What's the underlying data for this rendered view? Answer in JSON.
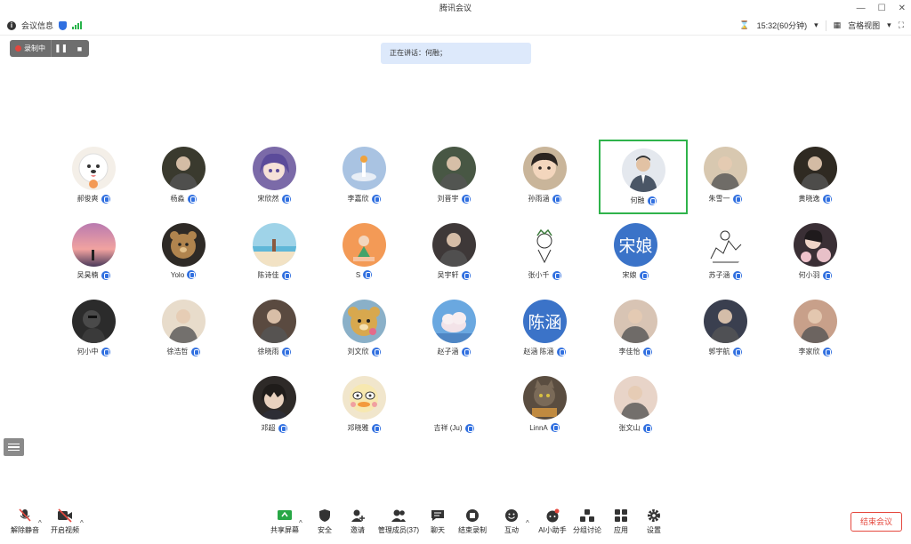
{
  "window": {
    "title": "腾讯会议"
  },
  "infobar": {
    "meeting_info": "会议信息",
    "time": "15:32(60分钟)",
    "layout": "宫格视图"
  },
  "recording": {
    "label": "录制中"
  },
  "speaking": {
    "text": "正在讲话：何融；"
  },
  "participants": [
    {
      "name": "郝俊爽",
      "avatar": "dog",
      "bg": "#f4efe8"
    },
    {
      "name": "杨淼",
      "avatar": "photo",
      "bg": "#3a3a2e"
    },
    {
      "name": "宋欣然",
      "avatar": "anime",
      "bg": "#7b6aa8"
    },
    {
      "name": "李嘉欣",
      "avatar": "sky",
      "bg": "#a9c3e2"
    },
    {
      "name": "刘晋宇",
      "avatar": "photo",
      "bg": "#485744"
    },
    {
      "name": "孙雨涵",
      "avatar": "child",
      "bg": "#c9b59a"
    },
    {
      "name": "何融",
      "avatar": "man",
      "bg": "#e4e8ee",
      "active": true
    },
    {
      "name": "朱雪一",
      "avatar": "photo",
      "bg": "#d8c8b0"
    },
    {
      "name": "黄晓逸",
      "avatar": "photo",
      "bg": "#2f2a22"
    },
    {
      "name": "吴昊楠",
      "avatar": "sunset",
      "bg": "#c87aa0"
    },
    {
      "name": "Yolo",
      "avatar": "bear",
      "bg": "#b0844e"
    },
    {
      "name": "陈诗佳",
      "avatar": "beach",
      "bg": "#9fd3e8"
    },
    {
      "name": "S",
      "avatar": "orange",
      "bg": "#f39a56"
    },
    {
      "name": "吴宇轩",
      "avatar": "photo",
      "bg": "#3e3838"
    },
    {
      "name": "张小千",
      "avatar": "sketch",
      "bg": "#ffffff"
    },
    {
      "name": "宋娘",
      "avatar": "text",
      "text": "宋娘",
      "bg": "#3b73c8"
    },
    {
      "name": "苏子涵",
      "avatar": "sketch2",
      "bg": "#ffffff"
    },
    {
      "name": "何小羽",
      "avatar": "flower",
      "bg": "#e8c0c8"
    },
    {
      "name": "何小中",
      "avatar": "dark",
      "bg": "#2b2b2b"
    },
    {
      "name": "徐浩哲",
      "avatar": "photo",
      "bg": "#e8dccb"
    },
    {
      "name": "徐晓雨",
      "avatar": "photo",
      "bg": "#5a4a40"
    },
    {
      "name": "刘文欣",
      "avatar": "teddy",
      "bg": "#d8a84e"
    },
    {
      "name": "赵子涵",
      "avatar": "cloud",
      "bg": "#6aa8e0"
    },
    {
      "name": "赵涵 陈涵",
      "avatar": "text",
      "text": "陈涵",
      "bg": "#3b73c8"
    },
    {
      "name": "李佳怡",
      "avatar": "photo",
      "bg": "#d8c4b4"
    },
    {
      "name": "郭宇航",
      "avatar": "photo",
      "bg": "#3a3f4f"
    },
    {
      "name": "李家欣",
      "avatar": "photo",
      "bg": "#c8a08a"
    },
    {
      "name": "邓超",
      "avatar": "anime2",
      "bg": "#2e2a28"
    },
    {
      "name": "邓晓雅",
      "avatar": "duck",
      "bg": "#f1e6cc"
    },
    {
      "name": "吉祥 (Ju)",
      "avatar": "none",
      "bg": "#ffffff"
    },
    {
      "name": "LinnA",
      "avatar": "cat",
      "bg": "#7a6a58"
    },
    {
      "name": "张文山",
      "avatar": "photo",
      "bg": "#e8d4c8"
    }
  ],
  "toolbar": {
    "mute": "解除静音",
    "video": "开启视频",
    "share": "共享屏幕",
    "security": "安全",
    "invite": "邀请",
    "manage": "管理成员(37)",
    "chat": "聊天",
    "record": "结束录制",
    "interact": "互动",
    "ai": "AI小助手",
    "breakout": "分组讨论",
    "apps": "应用",
    "settings": "设置",
    "end": "结束会议"
  }
}
